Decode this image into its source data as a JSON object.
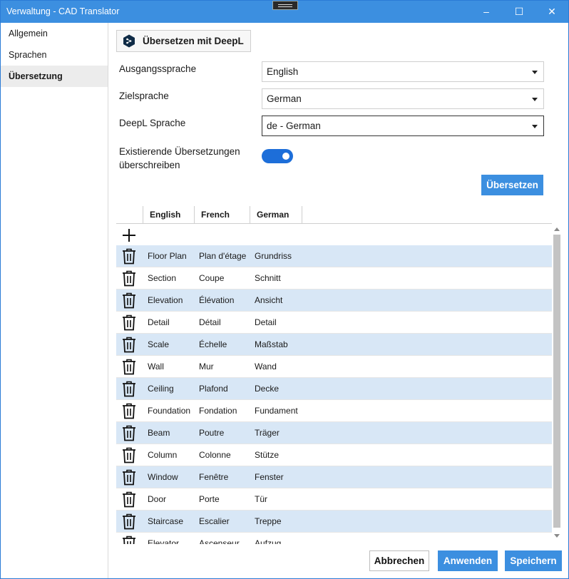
{
  "window": {
    "title": "Verwaltung - CAD Translator",
    "minimize_glyph": "–",
    "maximize_glyph": "☐",
    "close_glyph": "✕"
  },
  "sidebar": {
    "items": [
      {
        "label": "Allgemein"
      },
      {
        "label": "Sprachen"
      },
      {
        "label": "Übersetzung"
      }
    ],
    "active_index": 2
  },
  "deepl_section": {
    "button_label": "Übersetzen mit DeepL",
    "source_language_label": "Ausgangssprache",
    "source_language_value": "English",
    "target_language_label": "Zielsprache",
    "target_language_value": "German",
    "deepl_language_label": "DeepL Sprache",
    "deepl_language_value": "de - German",
    "overwrite_label_line1": "Existierende Übersetzungen",
    "overwrite_label_line2": "überschreiben",
    "overwrite_enabled": true,
    "translate_button_label": "Übersetzen"
  },
  "table": {
    "columns": [
      "English",
      "French",
      "German"
    ],
    "rows": [
      [
        "Floor Plan",
        "Plan d'étage",
        "Grundriss"
      ],
      [
        "Section",
        "Coupe",
        "Schnitt"
      ],
      [
        "Elevation",
        "Élévation",
        "Ansicht"
      ],
      [
        "Detail",
        "Détail",
        "Detail"
      ],
      [
        "Scale",
        "Échelle",
        "Maßstab"
      ],
      [
        "Wall",
        "Mur",
        "Wand"
      ],
      [
        "Ceiling",
        "Plafond",
        "Decke"
      ],
      [
        "Foundation",
        "Fondation",
        "Fundament"
      ],
      [
        "Beam",
        "Poutre",
        "Träger"
      ],
      [
        "Column",
        "Colonne",
        "Stütze"
      ],
      [
        "Window",
        "Fenêtre",
        "Fenster"
      ],
      [
        "Door",
        "Porte",
        "Tür"
      ],
      [
        "Staircase",
        "Escalier",
        "Treppe"
      ],
      [
        "Elevator",
        "Ascenseur",
        "Aufzug"
      ]
    ]
  },
  "footer": {
    "cancel_label": "Abbrechen",
    "apply_label": "Anwenden",
    "save_label": "Speichern"
  },
  "colors": {
    "accent": "#3c8fe0",
    "row_highlight": "#d8e7f6",
    "toggle_on": "#1d6ed9"
  }
}
